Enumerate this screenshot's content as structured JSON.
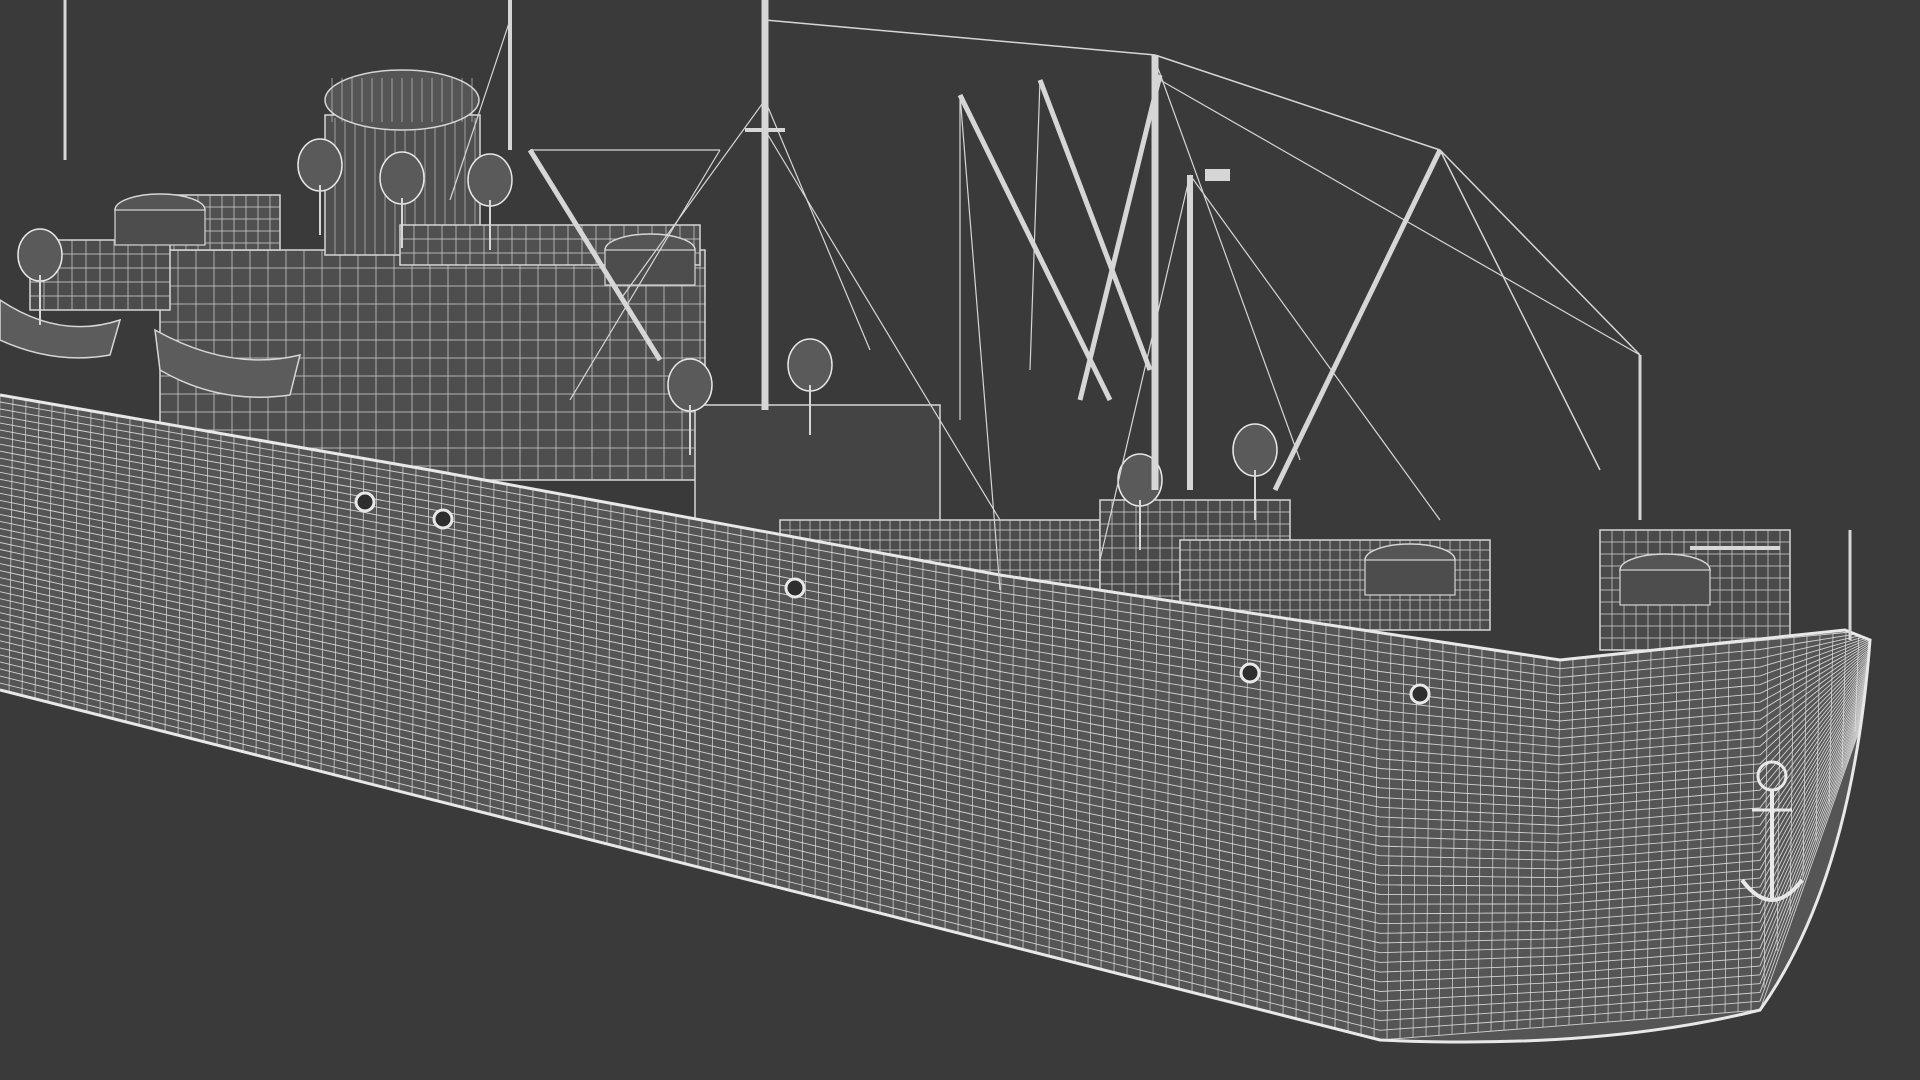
{
  "scene": {
    "subject": "wireframe-cargo-ship",
    "background_color": "#3a3a3a",
    "wire_color": "#d6d6d6",
    "solid_color": "#4a4a4a",
    "mesh_bright_color": "#e8e8e8"
  }
}
